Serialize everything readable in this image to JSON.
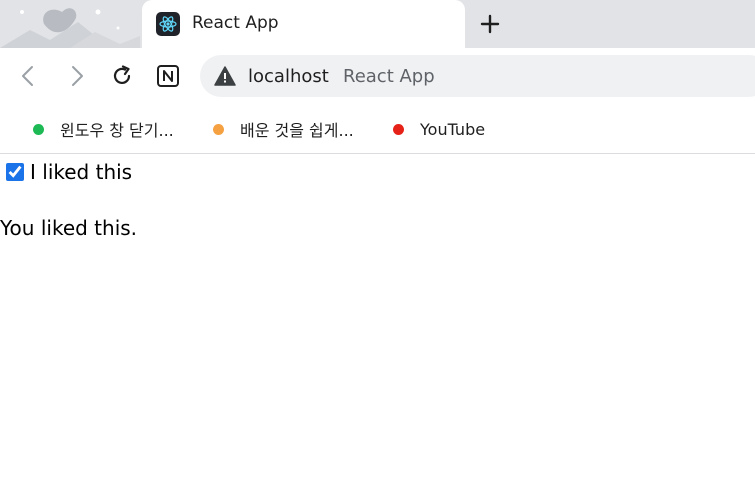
{
  "browser": {
    "tab": {
      "title": "React App",
      "favicon": "react-logo-icon"
    },
    "newtab_icon": "plus-icon",
    "toolbar": {
      "back_icon": "chevron-left-icon",
      "forward_icon": "chevron-right-icon",
      "reload_icon": "reload-icon",
      "extension_icon": "notion-icon",
      "url_host": "localhost",
      "url_title": "React App",
      "security_icon": "warning-icon"
    },
    "bookmarks": [
      {
        "label": "윈도우 창 닫기...",
        "color": "#1db954"
      },
      {
        "label": "배운 것을 쉽게...",
        "color": "#f5a142"
      },
      {
        "label": "YouTube",
        "color": "#e62117"
      }
    ]
  },
  "page": {
    "checkbox_label": "I liked this",
    "checked": true,
    "status_text": "You liked this."
  }
}
